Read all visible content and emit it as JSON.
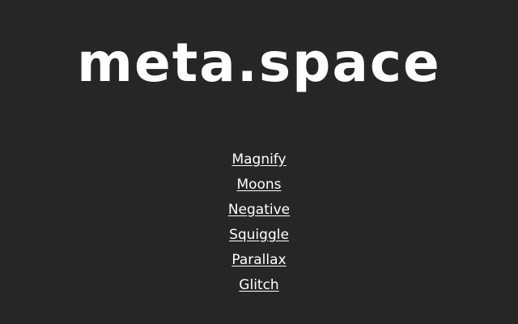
{
  "site": {
    "title": "meta.space"
  },
  "menu": {
    "items": [
      {
        "label": "Magnify"
      },
      {
        "label": "Moons"
      },
      {
        "label": "Negative"
      },
      {
        "label": "Squiggle"
      },
      {
        "label": "Parallax"
      },
      {
        "label": "Glitch"
      }
    ]
  },
  "colors": {
    "background": "#262626",
    "text": "#ffffff"
  }
}
